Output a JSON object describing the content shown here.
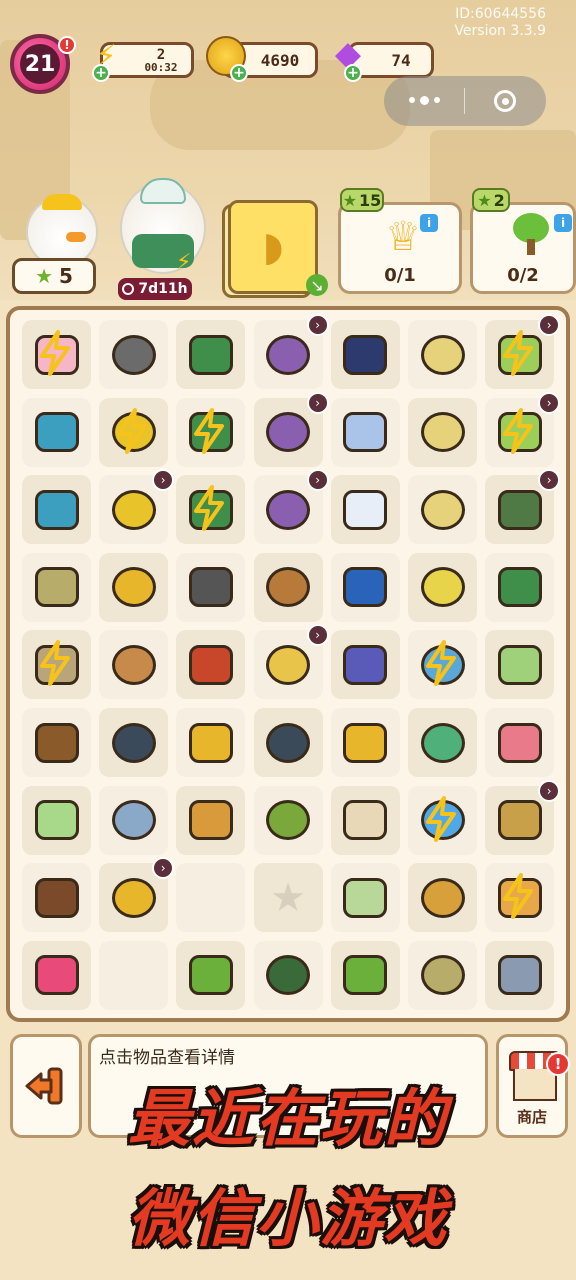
{
  "header": {
    "level": "21",
    "energy": {
      "value": "2",
      "timer": "00:32"
    },
    "coins": "4690",
    "gems": "74",
    "id_line": "ID:60644556",
    "version_line": "Version 3.3.9"
  },
  "characters": {
    "helper_count": "5",
    "event_timer": "7d11h"
  },
  "tasks": [
    {
      "reward": "15",
      "progress": "0/1",
      "icon": "trophy-icon"
    },
    {
      "reward": "2",
      "progress": "0/2",
      "icon": "money-tree-icon"
    }
  ],
  "board": {
    "rows": [
      [
        "snack-box",
        "wheel-pair",
        "toolbox",
        "junk-pile",
        "headphones",
        "picture-frame",
        "laptop"
      ],
      [
        "puzzle-piece",
        "shopping-cart",
        "toolbox-open",
        "junk-pile",
        "pillow",
        "frame-stack",
        "retro-tv"
      ],
      [
        "puzzle-piece-small",
        "shopping-basket",
        "toolbox-full",
        "junk-pile",
        "cassette-player",
        "basket",
        "radio"
      ],
      [
        "seed-bag",
        "cabinet",
        "caster-wheel",
        "woven-basket",
        "hair-dryer",
        "dumbbell-basket",
        "megaphone"
      ],
      [
        "lamp",
        "hamsters",
        "keys",
        "plant-cup",
        "game-console",
        "cart-small",
        "photo-card"
      ],
      [
        "rope",
        "weight-plates",
        "coins",
        "kettlebell",
        "bead-strand",
        "cash",
        "flower-box"
      ],
      [
        "egg-bowl",
        "resistance-band",
        "drawer-chest",
        "seed-pack",
        "bandage-box",
        "cooler",
        "fruit-basket"
      ],
      [
        "hot-cocoa",
        "tote-bag",
        "empty",
        "star-slot",
        "book",
        "juice-bottle",
        "shiba-item"
      ],
      [
        "backpack",
        "empty",
        "sprout-pot",
        "wire",
        "plant-pot",
        "seed-bag-small",
        "dumbbells"
      ]
    ]
  },
  "footer": {
    "hint": "点击物品查看详情",
    "shop_label": "商店"
  },
  "caption": {
    "line1": "最近在玩的",
    "line2": "微信小游戏"
  },
  "colors": {
    "accent_pink": "#d3246b",
    "caption_red": "#e53a22",
    "border_brown": "#a07a50"
  }
}
